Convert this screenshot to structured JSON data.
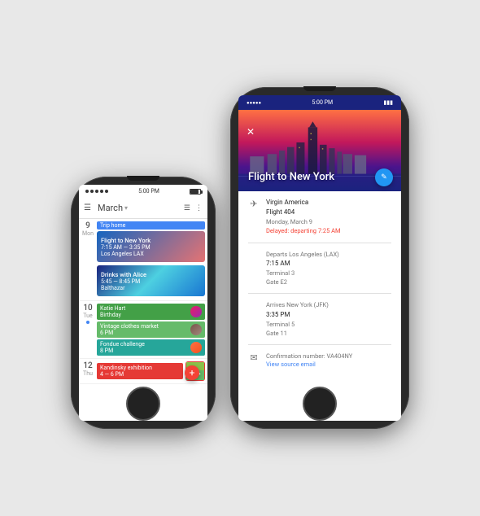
{
  "scene": {
    "bg_color": "#e8e8e8"
  },
  "small_phone": {
    "status": {
      "dots": 5,
      "time": "5:00 PM"
    },
    "header": {
      "menu_label": "☰",
      "month": "March",
      "dropdown_arrow": "▾",
      "calendar_icon": "📅",
      "more_icon": "⋮"
    },
    "days": [
      {
        "num": "9",
        "label": "Mon",
        "events": [
          {
            "type": "chip",
            "color": "blue",
            "text": "Trip home"
          },
          {
            "type": "card-flight",
            "title": "Flight to New York",
            "sub": "7:15 AM — 3:35 PM",
            "loc": "Los Angeles LAX"
          },
          {
            "type": "card-drinks",
            "title": "Drinks with Alice",
            "sub": "5:45 — 8:45 PM",
            "loc": "Balthazar"
          }
        ]
      },
      {
        "num": "10",
        "label": "Tue",
        "dot": true,
        "events": [
          {
            "type": "avatar-event",
            "text": "Katie Hart",
            "sub": "Birthday"
          },
          {
            "type": "green-chip",
            "text": "Vintage clothes market",
            "sub": "6 PM"
          },
          {
            "type": "avatar-event2",
            "text": "Fondue challenge",
            "sub": "8 PM"
          }
        ]
      },
      {
        "num": "12",
        "label": "Thu",
        "events": [
          {
            "type": "chip",
            "color": "green",
            "text": "Kandinsky exhibition",
            "sub": "4 — 6 PM"
          }
        ]
      }
    ],
    "fab": "+"
  },
  "large_phone": {
    "status": {
      "time": "5:00 PM"
    },
    "hero": {
      "title": "Flight to New York",
      "close": "✕"
    },
    "edit_fab": "✏",
    "detail": {
      "airline": "Virgin America",
      "flight": "Flight 404",
      "date": "Monday, March 9",
      "alert": "Delayed: departing 7:25 AM",
      "depart_label": "Departs Los Angeles (LAX)",
      "depart_time": "7:15 AM",
      "depart_terminal": "Terminal 3",
      "depart_gate": "Gate E2",
      "arrive_label": "Arrives New York (JFK)",
      "arrive_time": "3:35 PM",
      "arrive_terminal": "Terminal 5",
      "arrive_gate": "Gate 11",
      "confirmation_label": "Confirmation number: VA404NY",
      "source_link": "View source email",
      "plane_icon": "✈",
      "email_icon": "✉"
    }
  }
}
